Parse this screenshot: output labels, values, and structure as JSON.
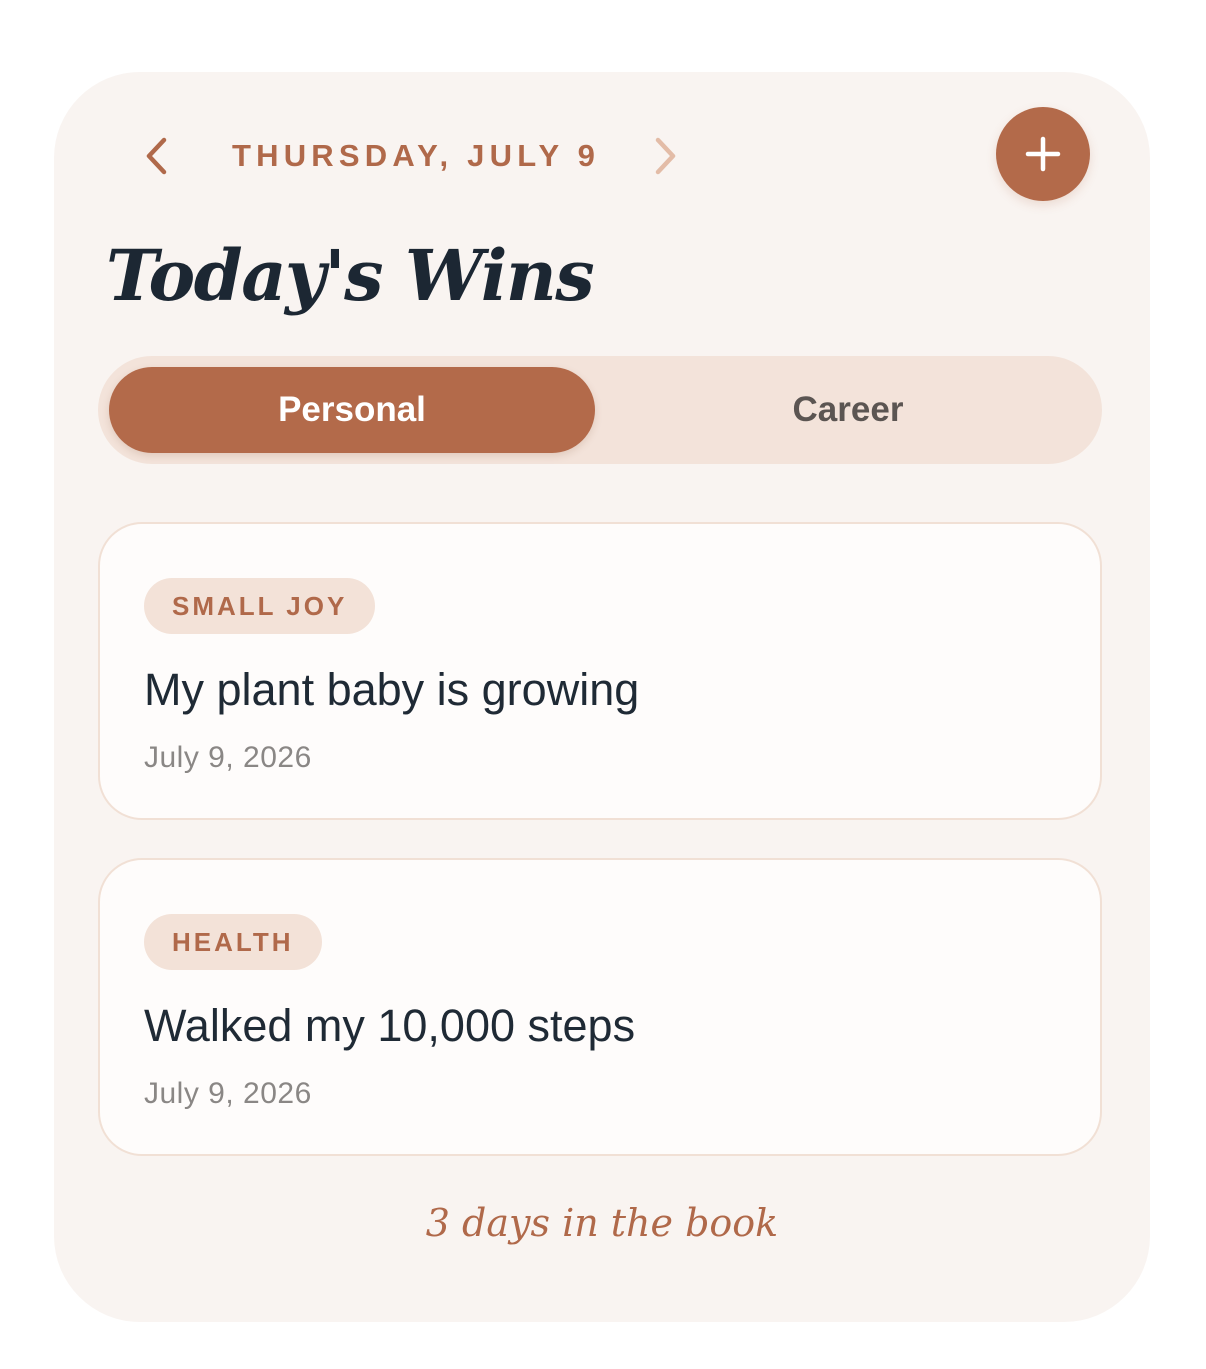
{
  "header": {
    "date_label": "THURSDAY, JULY 9",
    "prev_icon": "chevron-left-icon",
    "next_icon": "chevron-right-icon",
    "add_icon": "plus-icon"
  },
  "title": "Today's Wins",
  "tabs": [
    {
      "label": "Personal",
      "selected": true
    },
    {
      "label": "Career",
      "selected": false
    }
  ],
  "wins": [
    {
      "tag": "SMALL JOY",
      "title": "My plant baby is growing",
      "date": "July 9, 2026"
    },
    {
      "tag": "HEALTH",
      "title": "Walked my 10,000 steps",
      "date": "July 9, 2026"
    }
  ],
  "footer": {
    "streak_text": "3 days in the book"
  },
  "colors": {
    "accent": "#b36a4a",
    "background": "#f9f4f1",
    "title_text": "#1c2733",
    "tag_background": "#f3e2d8"
  }
}
